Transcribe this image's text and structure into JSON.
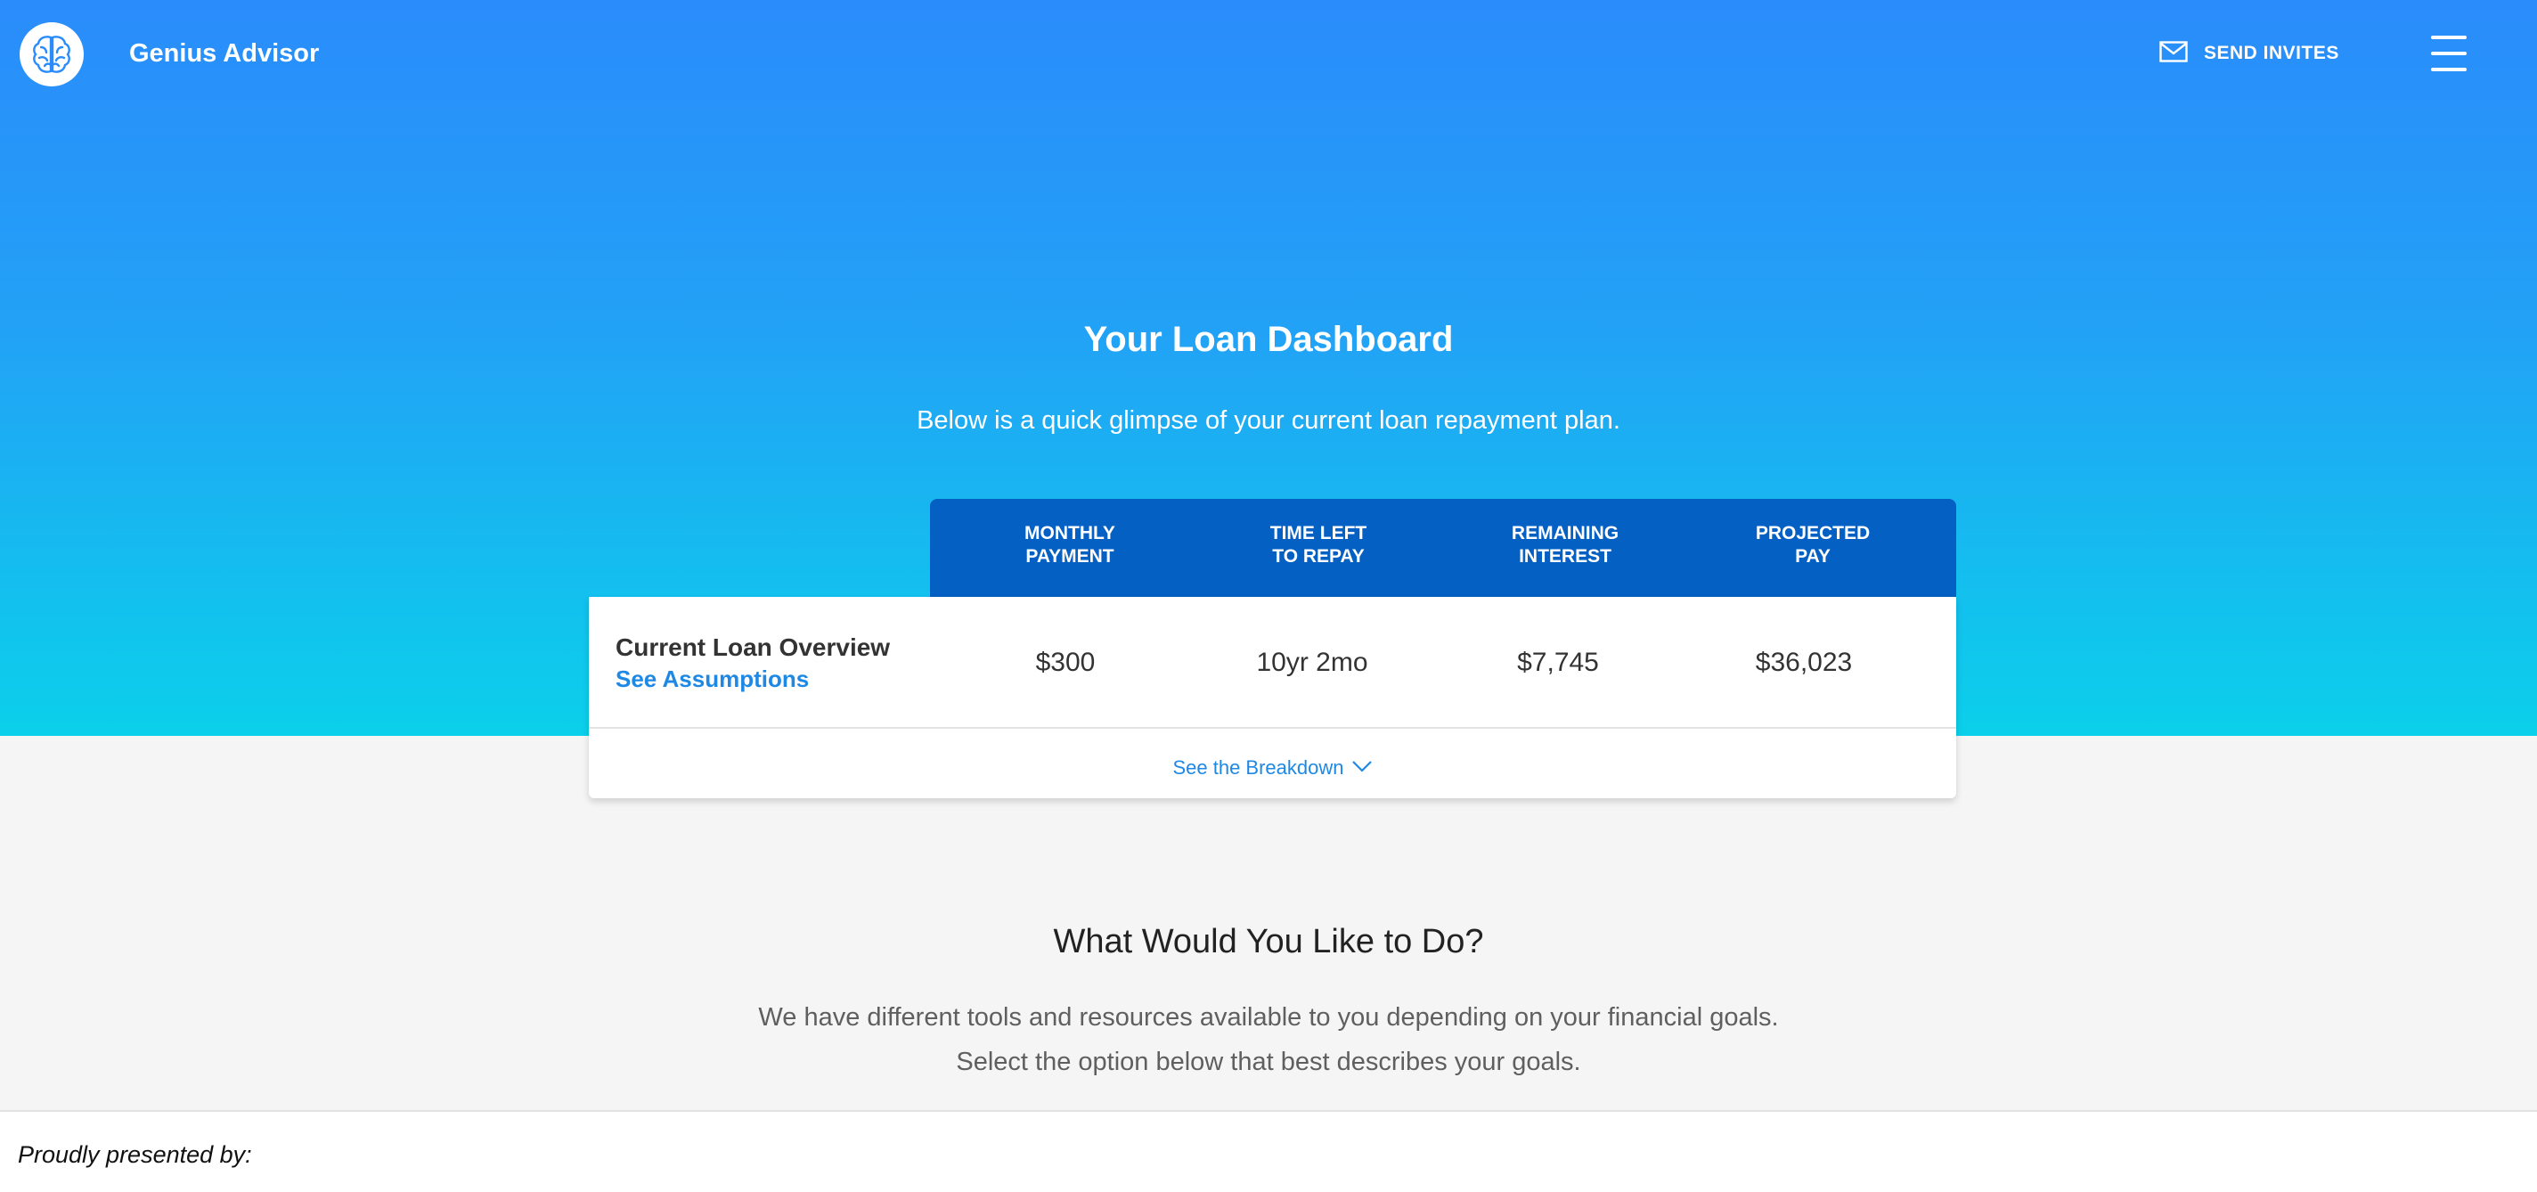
{
  "header": {
    "app_name": "Genius Advisor",
    "logo_icon": "brain-icon",
    "send_invites_label": "SEND INVITES",
    "send_invites_icon": "envelope-icon",
    "menu_icon": "hamburger-menu-icon"
  },
  "hero": {
    "title": "Your Loan Dashboard",
    "subtitle": "Below is a quick glimpse of your current loan repayment plan."
  },
  "loan_table": {
    "headers": [
      {
        "line1": "MONTHLY",
        "line2": "PAYMENT"
      },
      {
        "line1": "TIME LEFT",
        "line2": "TO REPAY"
      },
      {
        "line1": "REMAINING",
        "line2": "INTEREST"
      },
      {
        "line1": "PROJECTED",
        "line2": "PAY"
      }
    ],
    "row": {
      "title": "Current Loan Overview",
      "link": "See Assumptions",
      "values": [
        "$300",
        "10yr 2mo",
        "$7,745",
        "$36,023"
      ]
    },
    "breakdown_label": "See the Breakdown"
  },
  "goals_section": {
    "title": "What Would You Like to Do?",
    "line1": "We have different tools and resources available to you depending on your financial goals.",
    "line2": "Select the option below that best describes your goals."
  },
  "footer": {
    "text": "Proudly presented by:"
  },
  "colors": {
    "hero_top": "#2a8cfb",
    "hero_bottom": "#0bd0ea",
    "table_header": "#0560c4",
    "link": "#1e88e5",
    "page_background": "#f5f5f5"
  }
}
